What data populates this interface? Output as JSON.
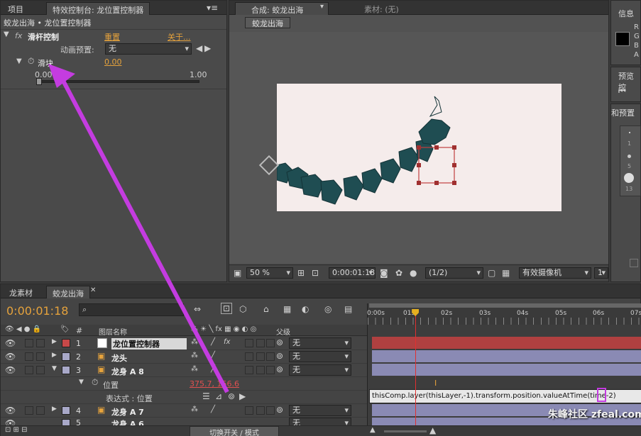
{
  "project_tab": "项目",
  "effects_tab": "特效控制台: 龙位置控制器",
  "breadcrumb": "蛟龙出海 • 龙位置控制器",
  "effect": {
    "fx_label": "fx",
    "name": "滑杆控制",
    "reset": "重置",
    "about": "关于...",
    "preset_label": "动画预置:",
    "preset_value": "无",
    "param_name": "滑块",
    "param_value": "0.00",
    "slider_min": "0.00",
    "slider_max": "1.00",
    "slider_value": 0
  },
  "comp_viewer": {
    "tab": "合成: 蛟龙出海",
    "footage_tab": "素材: (无)",
    "comp_button": "蛟龙出海",
    "zoom": "50 %",
    "timecode": "0:00:01:18",
    "resolution": "(1/2)",
    "camera": "有效摄像机",
    "views": "1"
  },
  "right_panel": {
    "info_tab": "信息",
    "rgba": [
      "R",
      "G",
      "B",
      "A"
    ],
    "preview_tab": "预览控",
    "presets_tab": "和预置",
    "brush_sizes": [
      "1",
      "5",
      "13"
    ]
  },
  "timeline": {
    "tabs": [
      "龙素材",
      "蛟龙出海"
    ],
    "timecode": "0:00:01:18",
    "search_placeholder": "",
    "col_hash": "#",
    "col_source": "图层名称",
    "col_parent": "父级",
    "ruler": [
      "0:00s",
      "01s",
      "02s",
      "03s",
      "04s",
      "05s",
      "06s",
      "07s"
    ],
    "current_time_fraction": 0.176,
    "layers": [
      {
        "num": "1",
        "name": "龙位置控制器",
        "parent": "无",
        "label_color": "#c84848"
      },
      {
        "num": "2",
        "name": "龙头",
        "parent": "无",
        "label_color": "#a8a8c8"
      },
      {
        "num": "3",
        "name": "龙身 A 8",
        "parent": "无",
        "label_color": "#a8a8c8"
      },
      {
        "num": "4",
        "name": "龙身 A 7",
        "parent": "无",
        "label_color": "#a8a8c8"
      },
      {
        "num": "5",
        "name": "龙身 A 6",
        "parent": "无",
        "label_color": "#a8a8c8"
      }
    ],
    "position_label": "位置",
    "position_value": "375.7, 156.6",
    "expression_label": "表达式 : 位置",
    "expression": "thisComp.layer(thisLayer,-1).transform.position.valueAtTime(time-2)",
    "toggle_mode": "切换开关 / 模式"
  },
  "watermark": "朱峰社区 zfeal.com",
  "colors": {
    "accent_orange": "#e5a23c",
    "arrow": "#c43ce0",
    "bar_purple": "#8a8ab4",
    "bar_red": "#b04040",
    "playhead": "#e03030"
  }
}
